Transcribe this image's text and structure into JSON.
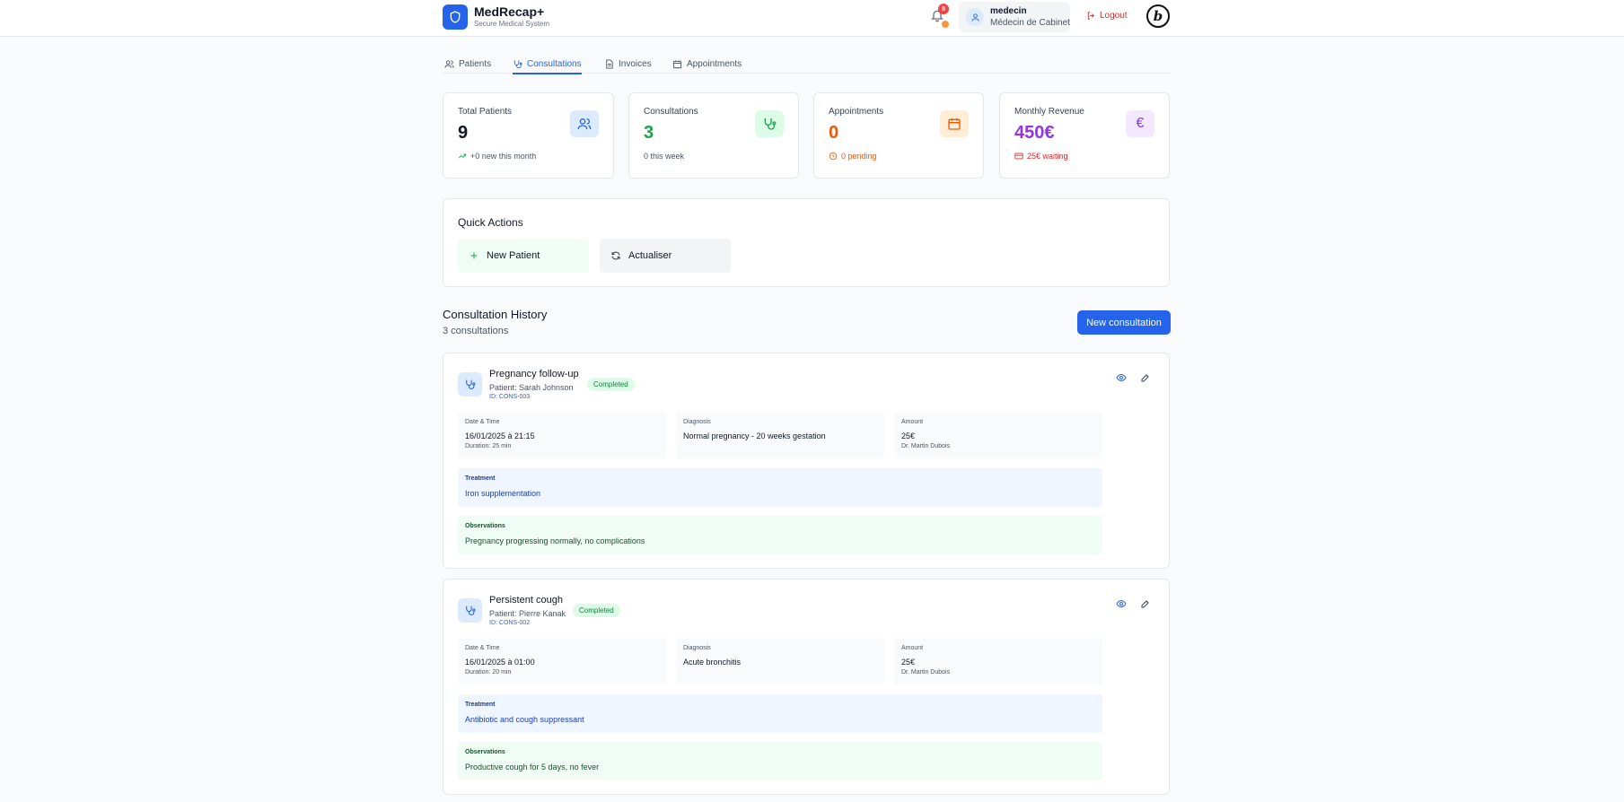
{
  "app": {
    "name": "MedRecap+",
    "subtitle": "Secure Medical System",
    "notifications_count": "8",
    "user": {
      "name": "medecin",
      "role": "Médecin de Cabinet"
    },
    "logout_label": "Logout",
    "brand_logo_letter": "b"
  },
  "tabs": [
    {
      "label": "Patients",
      "icon": "users-icon"
    },
    {
      "label": "Consultations",
      "icon": "stethoscope-icon",
      "active": true
    },
    {
      "label": "Invoices",
      "icon": "file-icon"
    },
    {
      "label": "Appointments",
      "icon": "calendar-icon"
    }
  ],
  "stats": [
    {
      "label": "Total Patients",
      "value": "9",
      "sub": "+0 new this month",
      "color": "#111827",
      "sub_color": "#16a34a",
      "icon": "users-icon",
      "icon_bg": "#dbeafe"
    },
    {
      "label": "Consultations",
      "value": "3",
      "sub": "0 this week",
      "color": "#16a34a",
      "sub_color": "#4b5563",
      "icon": "stethoscope-icon",
      "icon_bg": "#dcfce7"
    },
    {
      "label": "Appointments",
      "value": "0",
      "sub": "0 pending",
      "color": "#ea580c",
      "sub_color": "#ea580c",
      "icon": "calendar-icon",
      "icon_bg": "#ffedd5"
    },
    {
      "label": "Monthly Revenue",
      "value": "450€",
      "sub": "25€ waiting",
      "color": "#9333ea",
      "sub_color": "#dc2626",
      "icon": "euro-icon",
      "icon_bg": "#f3e8ff"
    }
  ],
  "quick_actions": {
    "title": "Quick Actions",
    "new_patient": "New Patient",
    "refresh": "Actualiser"
  },
  "history": {
    "title": "Consultation History",
    "count": "3 consultations",
    "new_button": "New consultation",
    "labels": {
      "date": "Date & Time",
      "diagnosis": "Diagnosis",
      "amount": "Amount",
      "treatment": "Treatment",
      "observations": "Observations"
    },
    "items": [
      {
        "title": "Pregnancy follow-up",
        "patient": "Patient: Sarah Johnson",
        "id": "ID: CONS-003",
        "status": "Completed",
        "date": "16/01/2025 à 21:15",
        "duration": "Duration: 25 min",
        "diagnosis": "Normal pregnancy - 20 weeks gestation",
        "amount": "25€",
        "doctor": "Dr. Martin Dubois",
        "treatment": "Iron supplementation",
        "observations": "Pregnancy progressing normally, no complications"
      },
      {
        "title": "Persistent cough",
        "patient": "Patient: Pierre Kanak",
        "id": "ID: CONS-002",
        "status": "Completed",
        "date": "16/01/2025 à 01:00",
        "duration": "Duration: 20 min",
        "diagnosis": "Acute bronchitis",
        "amount": "25€",
        "doctor": "Dr. Martin Dubois",
        "treatment": "Antibiotic and cough suppressant",
        "observations": "Productive cough for 5 days, no fever"
      }
    ]
  }
}
